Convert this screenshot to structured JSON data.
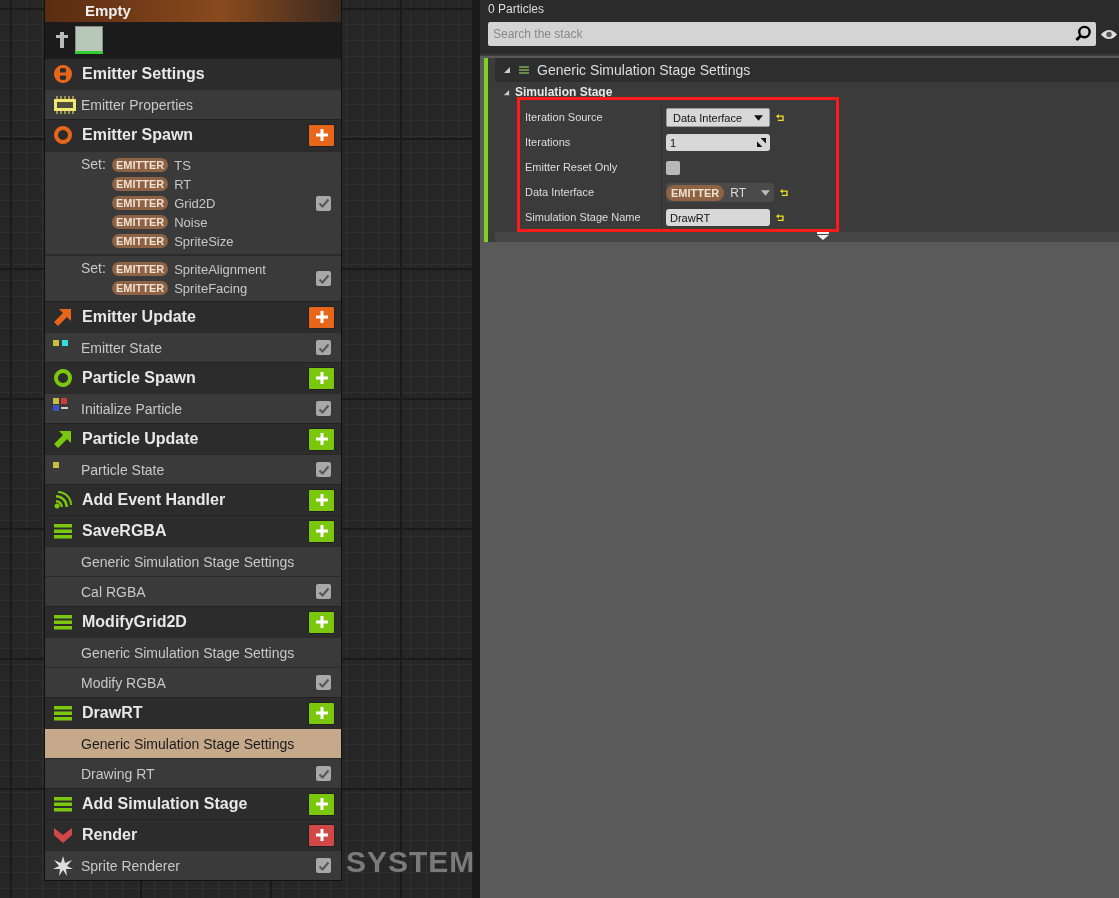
{
  "graph": {
    "overlay_label": "SYSTEM"
  },
  "node": {
    "title": "Empty",
    "sections": [
      {
        "kind": "header",
        "title": "Emitter Settings",
        "color": "#e8661a",
        "addable": false
      },
      {
        "kind": "item",
        "label": "Emitter Properties",
        "selected": false
      },
      {
        "kind": "header",
        "title": "Emitter Spawn",
        "color": "#e8661a",
        "addable": true
      },
      {
        "kind": "set",
        "prefix": "Set:",
        "entries": [
          {
            "badge": "EMITTER",
            "name": "TS"
          },
          {
            "badge": "EMITTER",
            "name": "RT"
          },
          {
            "badge": "EMITTER",
            "name": "Grid2D"
          },
          {
            "badge": "EMITTER",
            "name": "Noise"
          },
          {
            "badge": "EMITTER",
            "name": "SpriteSize"
          }
        ],
        "checked": true
      },
      {
        "kind": "set",
        "prefix": "Set:",
        "entries": [
          {
            "badge": "EMITTER",
            "name": "SpriteAlignment"
          },
          {
            "badge": "EMITTER",
            "name": "SpriteFacing"
          }
        ],
        "checked": true
      },
      {
        "kind": "header",
        "title": "Emitter Update",
        "color": "#e8661a",
        "addable": true
      },
      {
        "kind": "item",
        "label": "Emitter State",
        "checked": true,
        "selected": false
      },
      {
        "kind": "header",
        "title": "Particle Spawn",
        "color": "#7ac70c",
        "addable": true
      },
      {
        "kind": "item",
        "label": "Initialize Particle",
        "checked": true,
        "selected": false
      },
      {
        "kind": "header",
        "title": "Particle Update",
        "color": "#7ac70c",
        "addable": true
      },
      {
        "kind": "item",
        "label": "Particle State",
        "checked": true,
        "selected": false
      },
      {
        "kind": "header",
        "title": "Add Event Handler",
        "color": "#7ac70c",
        "addable": true
      },
      {
        "kind": "header",
        "title": "SaveRGBA",
        "color": "#7ac70c",
        "addable": true
      },
      {
        "kind": "item",
        "label": "Generic Simulation Stage Settings",
        "selected": false
      },
      {
        "kind": "item",
        "label": "Cal RGBA",
        "checked": true,
        "selected": false
      },
      {
        "kind": "header",
        "title": "ModifyGrid2D",
        "color": "#7ac70c",
        "addable": true
      },
      {
        "kind": "item",
        "label": "Generic Simulation Stage Settings",
        "selected": false
      },
      {
        "kind": "item",
        "label": "Modify RGBA",
        "checked": true,
        "selected": false
      },
      {
        "kind": "header",
        "title": "DrawRT",
        "color": "#7ac70c",
        "addable": true
      },
      {
        "kind": "item",
        "label": "Generic Simulation Stage Settings",
        "selected": true
      },
      {
        "kind": "item",
        "label": "Drawing RT",
        "checked": true,
        "selected": false
      },
      {
        "kind": "header",
        "title": "Add Simulation Stage",
        "color": "#7ac70c",
        "addable": true
      },
      {
        "kind": "header",
        "title": "Render",
        "color": "#d24848",
        "addable": true
      },
      {
        "kind": "item",
        "label": "Sprite Renderer",
        "checked": true,
        "selected": false
      }
    ]
  },
  "stack": {
    "particle_count": "0 Particles",
    "search": {
      "placeholder": "Search the stack"
    },
    "panel_title": "Generic Simulation Stage Settings",
    "category": "Simulation Stage",
    "properties": [
      {
        "kind": "dropdown",
        "label": "Iteration Source",
        "value": "Data Interface",
        "resettable": true
      },
      {
        "kind": "number",
        "label": "Iterations",
        "value": "1",
        "resettable": false
      },
      {
        "kind": "checkbox",
        "label": "Emitter Reset Only",
        "checked": false,
        "resettable": false
      },
      {
        "kind": "emitter",
        "label": "Data Interface",
        "badge": "EMITTER",
        "value": "RT",
        "resettable": true
      },
      {
        "kind": "text",
        "label": "Simulation Stage Name",
        "value": "DrawRT",
        "resettable": true
      }
    ]
  }
}
